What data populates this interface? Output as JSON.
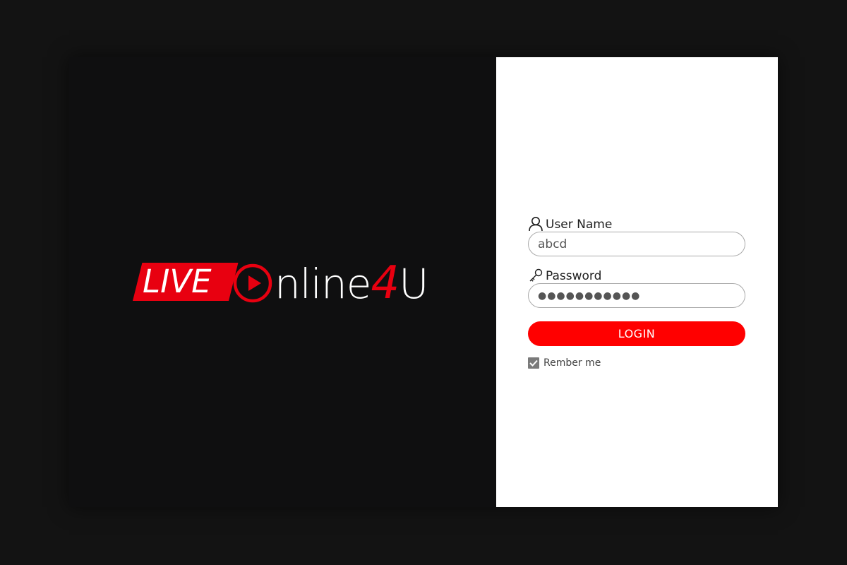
{
  "brand": {
    "live_text": "LIVE",
    "rest_text": "nline",
    "four_text": "4",
    "u_text": "U"
  },
  "login_form": {
    "username_label": "User Name",
    "username_value": "abcd",
    "password_label": "Password",
    "password_value": "●●●●●●●●●●●",
    "login_button": "LOGIN",
    "remember_label": "Rember me",
    "remember_checked": true
  },
  "colors": {
    "background": "#131313",
    "left_panel": "#0f0f10",
    "right_panel": "#ffffff",
    "accent_red": "#ff0000"
  },
  "icons": {
    "username": "user-icon",
    "password": "key-icon",
    "logo_play": "play-circle-icon",
    "remember": "checkmark-icon"
  }
}
